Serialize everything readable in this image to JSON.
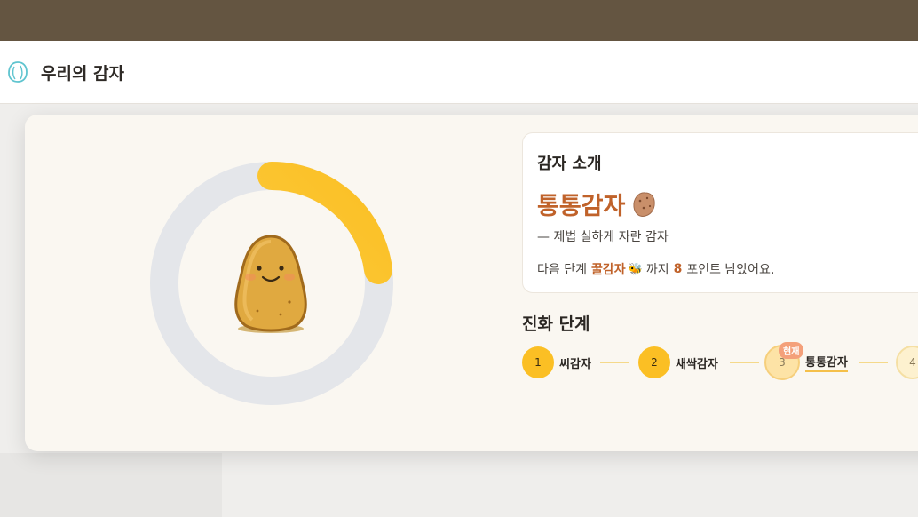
{
  "header": {
    "title": "우리의 감자"
  },
  "intro": {
    "heading": "감자 소개",
    "current_name": "통통감자",
    "description": "— 제법 실하게 자란 감자",
    "next_prefix": "다음 단계",
    "next_name": "꿀감자",
    "next_bee": "🐝",
    "next_mid": "까지",
    "next_points": "8",
    "next_suffix": "포인트 남았어요."
  },
  "evolution": {
    "title": "진화 단계",
    "current_badge": "현재",
    "stages": [
      {
        "num": "1",
        "label": "씨감자"
      },
      {
        "num": "2",
        "label": "새싹감자"
      },
      {
        "num": "3",
        "label": "통통감자"
      },
      {
        "num": "4",
        "label": ""
      }
    ]
  },
  "progress": {
    "fraction": 0.23
  },
  "colors": {
    "accent": "#c0622a",
    "ring_track": "#e4e6ea",
    "ring_fill": "#fbbf24",
    "stage_done": "#fbbf24"
  }
}
